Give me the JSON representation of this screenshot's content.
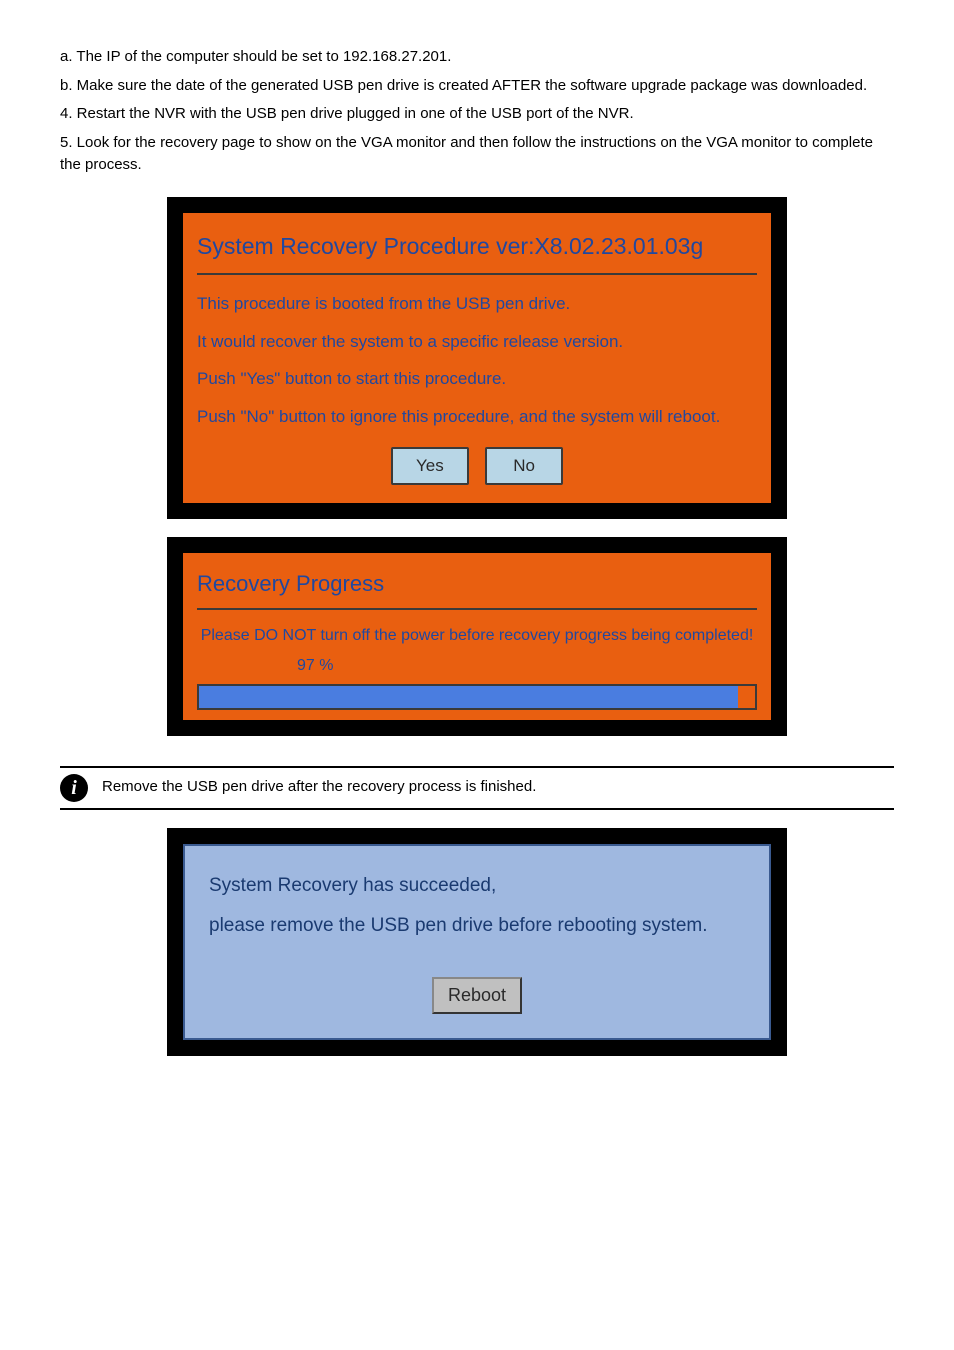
{
  "intro": {
    "a": "a. The IP of the computer should be set to 192.168.27.201.",
    "b": "b. Make sure the date of the generated USB pen drive is created AFTER the software upgrade package was downloaded.",
    "step4": "4. Restart the NVR with the USB pen drive plugged in one of the USB port of the NVR.",
    "step5": "5. Look for the recovery page to show on the VGA monitor and then follow the instructions on the VGA monitor to complete the process."
  },
  "panel1": {
    "title": "System Recovery Procedure   ver:X8.02.23.01.03g",
    "line1": "This procedure is booted from the USB pen drive.",
    "line2": "It would recover the system to a specific release version.",
    "line3": "Push \"Yes\" button to start this procedure.",
    "line4": "Push \"No\" button to ignore this procedure, and the system will reboot.",
    "yes": "Yes",
    "no": "No"
  },
  "progress": {
    "title": "Recovery Progress",
    "msg": "Please DO NOT turn off the power before recovery progress being completed!",
    "pct_label": "97 %",
    "pct_value": 97
  },
  "note": "Remove the USB pen drive after the recovery process is finished.",
  "success": {
    "line1": "System Recovery has succeeded,",
    "line2": "please remove the USB pen drive before rebooting system.",
    "reboot": "Reboot"
  }
}
